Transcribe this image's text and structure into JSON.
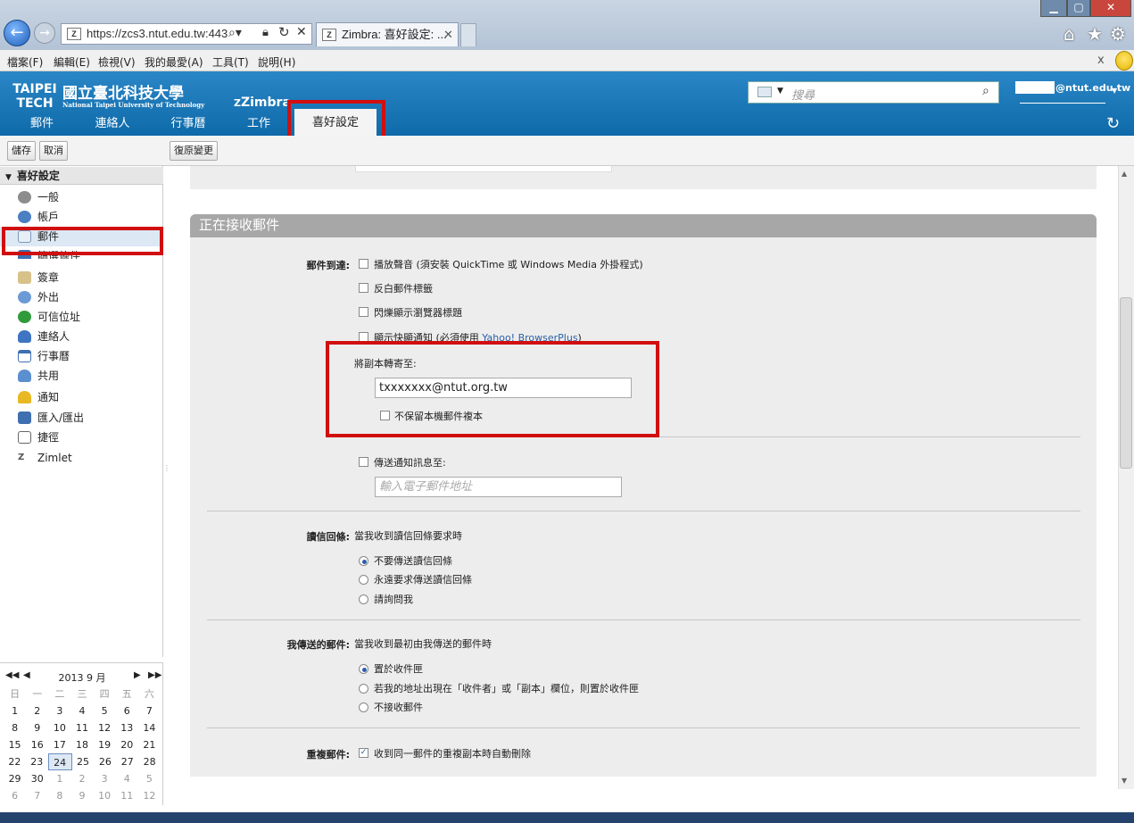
{
  "browser": {
    "url": "https://zcs3.ntut.edu.tw:443",
    "tab_title": "Zimbra: 喜好設定: ...",
    "window_controls": [
      "minimize",
      "maximize",
      "close"
    ],
    "menu": [
      "檔案(F)",
      "編輯(E)",
      "檢視(V)",
      "我的最愛(A)",
      "工具(T)",
      "說明(H)"
    ],
    "menu_close": "x"
  },
  "header": {
    "logo_en": "TAIPEI TECH",
    "logo_zh": "國立臺北科技大學",
    "logo_sub": "National Taipei University of Technology",
    "product": "Zimbra",
    "search_placeholder": "搜尋",
    "user_email": "@ntut.edu.tw",
    "nav_tabs": [
      "郵件",
      "連絡人",
      "行事曆",
      "工作",
      "喜好設定"
    ],
    "active_tab": "喜好設定"
  },
  "toolbar": {
    "save": "儲存",
    "cancel": "取消",
    "revert": "復原變更"
  },
  "sidebar": {
    "title": "喜好設定",
    "items": [
      "一般",
      "帳戶",
      "郵件",
      "篩選條件",
      "簽章",
      "外出",
      "可信位址",
      "連絡人",
      "行事曆",
      "共用",
      "通知",
      "匯入/匯出",
      "捷徑",
      "Zimlet"
    ],
    "selected": "郵件"
  },
  "calendar": {
    "title": "2013 9 月",
    "weekdays": [
      "日",
      "一",
      "二",
      "三",
      "四",
      "五",
      "六"
    ],
    "weeks": [
      [
        "1",
        "2",
        "3",
        "4",
        "5",
        "6",
        "7"
      ],
      [
        "8",
        "9",
        "10",
        "11",
        "12",
        "13",
        "14"
      ],
      [
        "15",
        "16",
        "17",
        "18",
        "19",
        "20",
        "21"
      ],
      [
        "22",
        "23",
        "24",
        "25",
        "26",
        "27",
        "28"
      ],
      [
        "29",
        "30",
        "1",
        "2",
        "3",
        "4",
        "5"
      ],
      [
        "6",
        "7",
        "8",
        "9",
        "10",
        "11",
        "12"
      ]
    ],
    "today": "24"
  },
  "section": {
    "title": "正在接收郵件",
    "arrival_label": "郵件到達:",
    "arrival_options": [
      "播放聲音 (須安裝 QuickTime 或 Windows Media 外掛程式)",
      "反白郵件標籤",
      "閃爍顯示瀏覽器標題",
      "顯示快顯通知 (必須使用 "
    ],
    "browserplus_link": "Yahoo! BrowserPlus",
    "browserplus_tail": ")",
    "forward_label": "將副本轉寄至:",
    "forward_value": "txxxxxxx@ntut.org.tw",
    "no_local_copy": "不保留本機郵件複本",
    "notify_label": "傳送通知訊息至:",
    "notify_placeholder": "輸入電子郵件地址",
    "receipt_label": "讀信回條:",
    "receipt_desc": "當我收到讀信回條要求時",
    "receipt_options": [
      "不要傳送讀信回條",
      "永遠要求傳送讀信回條",
      "請詢問我"
    ],
    "receipt_selected": 0,
    "sent_label": "我傳送的郵件:",
    "sent_desc": "當我收到最初由我傳送的郵件時",
    "sent_options": [
      "置於收件匣",
      "若我的地址出現在「收件者」或「副本」欄位，則置於收件匣",
      "不接收郵件"
    ],
    "sent_selected": 0,
    "dup_label": "重複郵件:",
    "dup_option": "收到同一郵件的重複副本時自動刪除",
    "dup_checked": true
  },
  "colors": {
    "header_blue": "#1a78b8",
    "highlight_red": "#d10f0f",
    "link_blue": "#2a5fa8"
  }
}
